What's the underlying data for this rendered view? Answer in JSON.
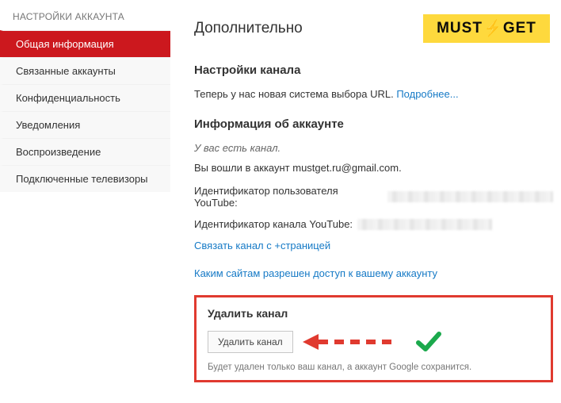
{
  "sidebar": {
    "title": "НАСТРОЙКИ АККАУНТА",
    "items": [
      {
        "label": "Общая информация",
        "active": true
      },
      {
        "label": "Связанные аккаунты",
        "active": false
      },
      {
        "label": "Конфиденциальность",
        "active": false
      },
      {
        "label": "Уведомления",
        "active": false
      },
      {
        "label": "Воспроизведение",
        "active": false
      },
      {
        "label": "Подключенные телевизоры",
        "active": false
      }
    ]
  },
  "header": {
    "title": "Дополнительно",
    "brand_left": "MUST",
    "brand_right": "GET"
  },
  "channel_settings": {
    "heading": "Настройки канала",
    "text": "Теперь у нас новая система выбора URL. ",
    "link": "Подробнее..."
  },
  "account_info": {
    "heading": "Информация об аккаунте",
    "has_channel": "У вас есть канал.",
    "signed_in_prefix": "Вы вошли в аккаунт ",
    "email": "mustget.ru@gmail.com.",
    "user_id_label": "Идентификатор пользователя YouTube:",
    "channel_id_label": "Идентификатор канала YouTube:",
    "link_plus_page": "Связать канал с +страницей",
    "link_access": "Каким сайтам разрешен доступ к вашему аккаунту"
  },
  "delete": {
    "heading": "Удалить канал",
    "button": "Удалить канал",
    "disclaimer": "Будет удален только ваш канал, а аккаунт Google сохранится."
  }
}
